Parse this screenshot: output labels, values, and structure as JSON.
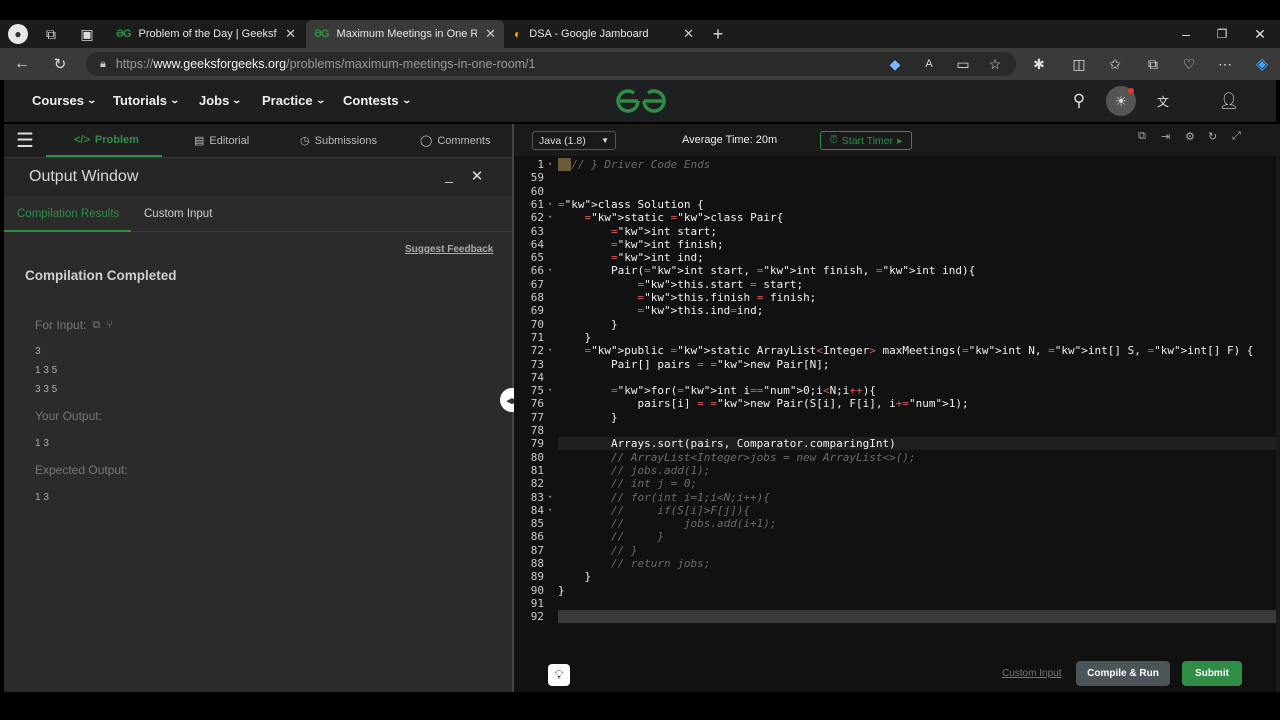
{
  "browser": {
    "tabs": [
      {
        "title": "Problem of the Day | GeeksforGe",
        "icon": "gfg-icon"
      },
      {
        "title": "Maximum Meetings in One Room",
        "icon": "gfg-icon"
      },
      {
        "title": "DSA - Google Jamboard",
        "icon": "jamboard-icon"
      }
    ],
    "url_prefix": "https://",
    "url_domain": "www.geeksforgeeks.org",
    "url_path": "/problems/maximum-meetings-in-one-room/1"
  },
  "nav": {
    "items": [
      "Courses",
      "Tutorials",
      "Jobs",
      "Practice",
      "Contests"
    ],
    "logo": "GG"
  },
  "panel_tabs": [
    "Problem",
    "Editorial",
    "Submissions",
    "Comments"
  ],
  "output_window": {
    "title": "Output Window",
    "subtabs": [
      "Compilation Results",
      "Custom Input"
    ],
    "feedback": "Suggest Feedback",
    "status": "Compilation Completed",
    "for_input_label": "For Input:",
    "input_lines": [
      "3",
      "1 3 5",
      "3 3 5"
    ],
    "your_output_label": "Your Output:",
    "your_output": "1 3",
    "expected_output_label": "Expected Output:",
    "expected_output": "1 3"
  },
  "editor": {
    "language": "Java (1.8)",
    "avg_time": "Average Time: 20m",
    "timer_label": "Start Timer",
    "custom_input": "Custom Input",
    "compile_run": "Compile & Run",
    "submit": "Submit",
    "lines": [
      {
        "n": "1",
        "t": "// } Driver Code Ends"
      },
      {
        "n": "59",
        "t": ""
      },
      {
        "n": "60",
        "t": ""
      },
      {
        "n": "61",
        "t": "class Solution {"
      },
      {
        "n": "62",
        "t": "    static class Pair{"
      },
      {
        "n": "63",
        "t": "        int start;"
      },
      {
        "n": "64",
        "t": "        int finish;"
      },
      {
        "n": "65",
        "t": "        int ind;"
      },
      {
        "n": "66",
        "t": "        Pair(int start, int finish, int ind){"
      },
      {
        "n": "67",
        "t": "            this.start = start;"
      },
      {
        "n": "68",
        "t": "            this.finish = finish;"
      },
      {
        "n": "69",
        "t": "            this.ind=ind;"
      },
      {
        "n": "70",
        "t": "        }"
      },
      {
        "n": "71",
        "t": "    }"
      },
      {
        "n": "72",
        "t": "    public static ArrayList<Integer> maxMeetings(int N, int[] S, int[] F) {"
      },
      {
        "n": "73",
        "t": "        Pair[] pairs = new Pair[N];"
      },
      {
        "n": "74",
        "t": ""
      },
      {
        "n": "75",
        "t": "        for(int i=0;i<N;i++){"
      },
      {
        "n": "76",
        "t": "            pairs[i] = new Pair(S[i], F[i], i+1);"
      },
      {
        "n": "77",
        "t": "        }"
      },
      {
        "n": "78",
        "t": ""
      },
      {
        "n": "79",
        "t": "        Arrays.sort(pairs, Comparator.comparingInt)"
      },
      {
        "n": "80",
        "t": "        // ArrayList<Integer>jobs = new ArrayList<>();"
      },
      {
        "n": "81",
        "t": "        // jobs.add(1);"
      },
      {
        "n": "82",
        "t": "        // int j = 0;"
      },
      {
        "n": "83",
        "t": "        // for(int i=1;i<N;i++){"
      },
      {
        "n": "84",
        "t": "        //     if(S[i]>F[j]){"
      },
      {
        "n": "85",
        "t": "        //         jobs.add(i+1);"
      },
      {
        "n": "86",
        "t": "        //     }"
      },
      {
        "n": "87",
        "t": "        // }"
      },
      {
        "n": "88",
        "t": "        // return jobs;"
      },
      {
        "n": "89",
        "t": "    }"
      },
      {
        "n": "90",
        "t": "}"
      },
      {
        "n": "91",
        "t": ""
      },
      {
        "n": "92",
        "t": ""
      }
    ]
  }
}
